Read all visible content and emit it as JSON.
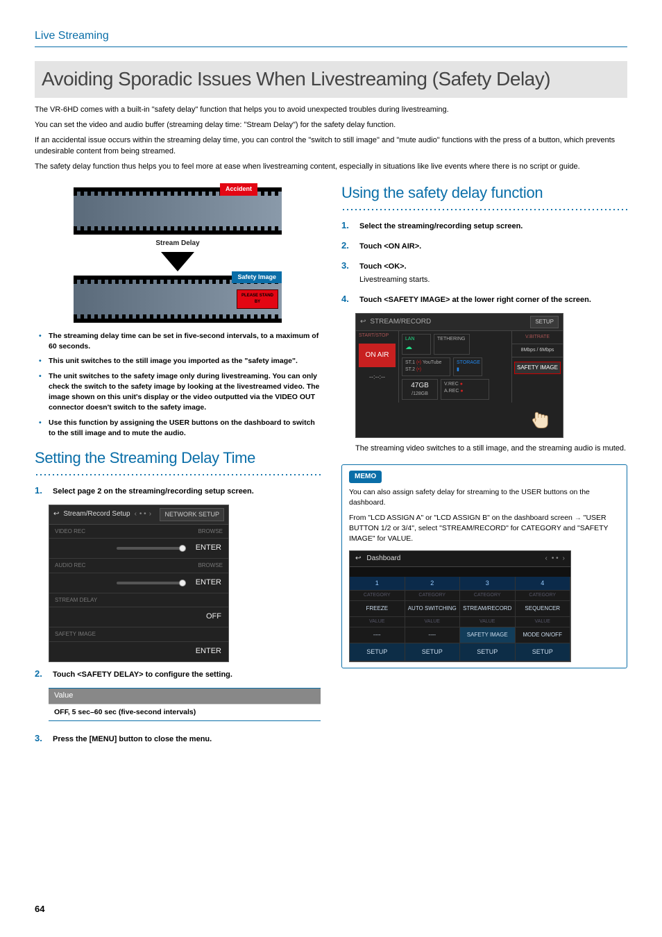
{
  "breadcrumb": "Live Streaming",
  "title": "Avoiding Sporadic Issues When Livestreaming (Safety Delay)",
  "intro": [
    "The VR-6HD comes with a built-in \"safety delay\" function that helps you to avoid unexpected troubles during livestreaming.",
    "You can set the video and audio buffer (streaming delay time: \"Stream Delay\") for the safety delay function.",
    "If an accidental issue occurs within the streaming delay time, you can control the \"switch to still image\" and \"mute audio\" functions with the press of a button, which prevents undesirable content from being streamed.",
    "The safety delay function thus helps you to feel more at ease when livestreaming content, especially in situations like live events where there is no script or guide."
  ],
  "diagram": {
    "accident_tag": "Accident",
    "stream_delay_label": "Stream Delay",
    "safety_image_tag": "Safety Image",
    "standby_label": "PLEASE STAND BY"
  },
  "bullets": [
    "The streaming delay time can be set in five-second intervals, to a maximum of 60 seconds.",
    "This unit switches to the still image you imported as the \"safety image\".",
    "The unit switches to the safety image only during livestreaming. You can only check the switch to the safety image by looking at the livestreamed video. The image shown on this unit's display or the video outputted via the VIDEO OUT connector doesn't switch to the safety image.",
    "Use this function by assigning the USER buttons on the dashboard to switch to the still image and to mute the audio."
  ],
  "left_section": {
    "heading": "Setting the Streaming Delay Time",
    "steps": [
      {
        "num": "1.",
        "bold": "Select page 2 on the streaming/recording setup screen."
      },
      {
        "num": "2.",
        "bold": "Touch <SAFETY DELAY> to configure the setting."
      },
      {
        "num": "3.",
        "bold": "Press the [MENU] button to close the menu."
      }
    ],
    "value_header": "Value",
    "value_row": "OFF, 5 sec–60 sec (five-second intervals)"
  },
  "setup_screen": {
    "title": "Stream/Record Setup",
    "pager": {
      "left": "‹",
      "dots": "• •",
      "right": "›"
    },
    "top_button": "NETWORK SETUP",
    "rows": [
      {
        "label": "VIDEO REC",
        "side": "BROWSE",
        "button": "ENTER"
      },
      {
        "label": "AUDIO REC",
        "side": "BROWSE",
        "button": "ENTER"
      },
      {
        "label": "STREAM DELAY",
        "button": "OFF"
      },
      {
        "label": "SAFETY IMAGE",
        "button": "ENTER"
      }
    ]
  },
  "right_section": {
    "heading": "Using the safety delay function",
    "steps": [
      {
        "num": "1.",
        "bold": "Select the streaming/recording setup screen."
      },
      {
        "num": "2.",
        "bold": "Touch <ON AIR>."
      },
      {
        "num": "3.",
        "bold": "Touch <OK>.",
        "text": "Livestreaming starts."
      },
      {
        "num": "4.",
        "bold": "Touch <SAFETY IMAGE> at the lower right corner of the screen."
      }
    ],
    "after_screenshot": "The streaming video switches to a still image, and the streaming audio is muted."
  },
  "stream_record": {
    "title": "STREAM/RECORD",
    "start_stop": "START/STOP",
    "on_air": "ON AIR",
    "time": "--:--:--",
    "lan": "LAN",
    "tether": "TETHERING",
    "st1": "ST.1",
    "st2": "ST.2",
    "youtube": "YouTube",
    "storage": "STORAGE",
    "gb": "47GB",
    "gb_total": "/128GB",
    "vrec": "V.REC",
    "arec": "A.REC",
    "setup": "SETUP",
    "bitrate_label": "V.BITRATE",
    "bitrate": "8Mbps / 6Mbps",
    "safety_image": "SAFETY IMAGE"
  },
  "memo": {
    "tag": "MEMO",
    "p1": "You can also assign safety delay for streaming to the USER buttons on the dashboard.",
    "p2_a": "From \"LCD ASSIGN A\" or \"LCD ASSIGN B\" on the dashboard screen ",
    "p2_b": " \"USER BUTTON 1/2 or 3/4\", select \"STREAM/RECORD\" for CATEGORY and \"SAFETY IMAGE\" for VALUE."
  },
  "dashboard": {
    "title": "Dashboard",
    "pager": {
      "left": "‹",
      "dots": "• •",
      "right": "›"
    },
    "nums": [
      "1",
      "2",
      "3",
      "4"
    ],
    "cat_label": "CATEGORY",
    "cats": [
      "FREEZE",
      "AUTO SWITCHING",
      "STREAM/RECORD",
      "SEQUENCER"
    ],
    "val_label": "VALUE",
    "vals": [
      "----",
      "----",
      "SAFETY IMAGE",
      "MODE ON/OFF"
    ],
    "setup": "SETUP"
  },
  "page_number": "64"
}
